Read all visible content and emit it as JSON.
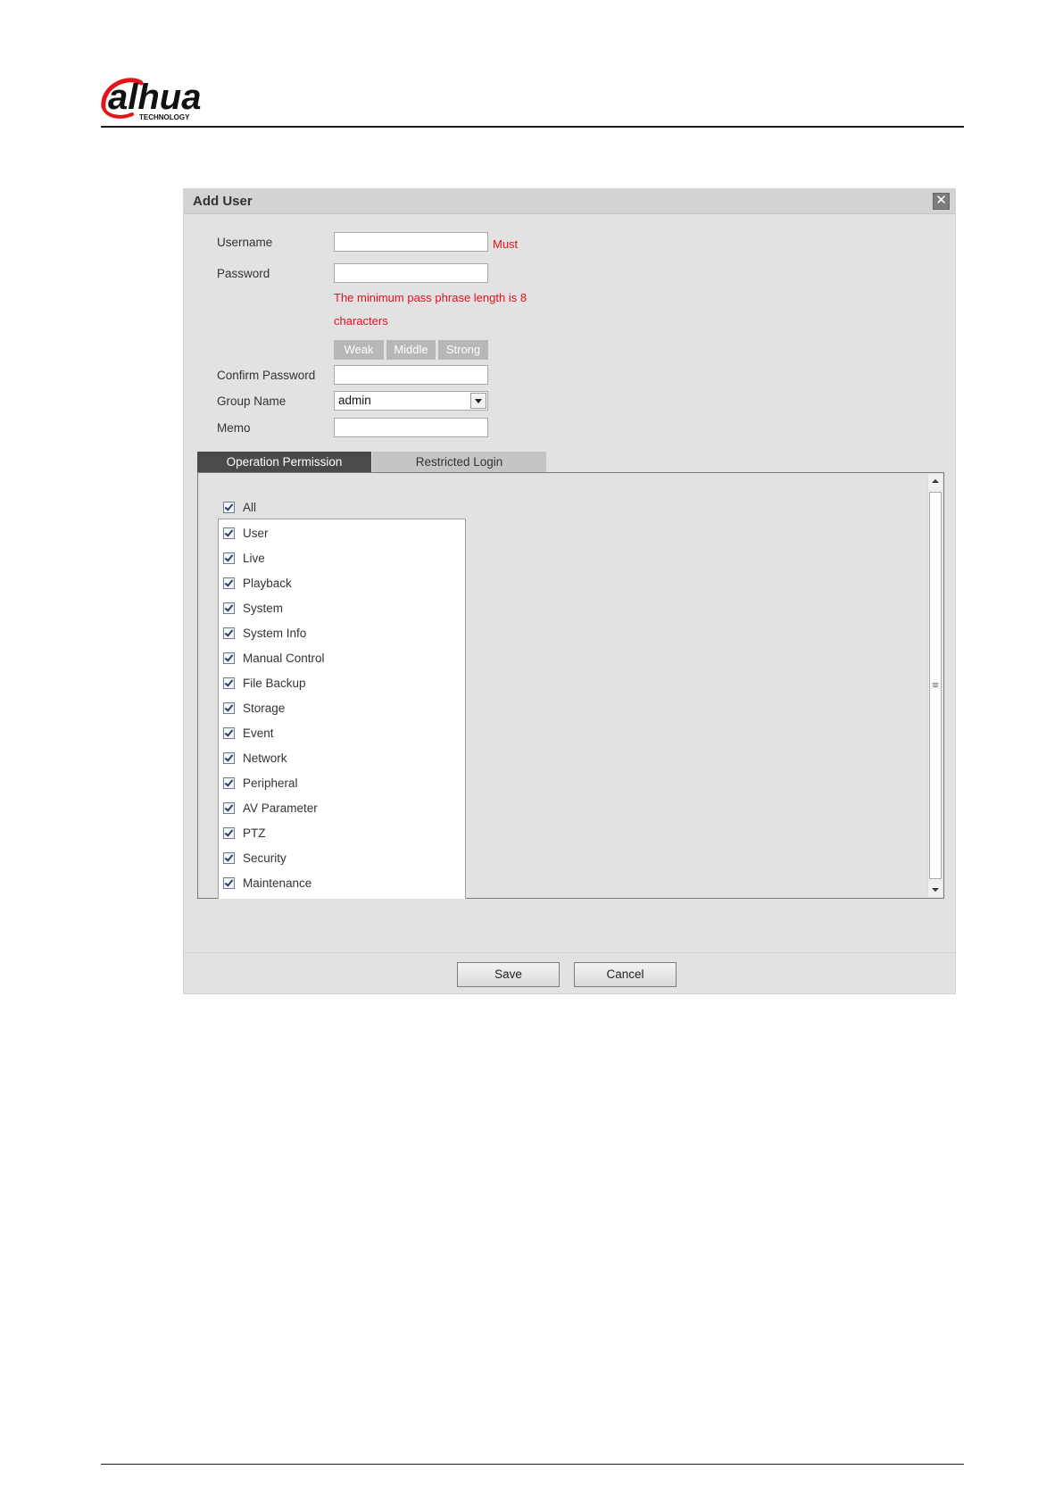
{
  "header": {
    "logo_text": "alhua",
    "logo_subtext": "TECHNOLOGY"
  },
  "dialog": {
    "title": "Add User",
    "close_icon": "close-icon",
    "fields": {
      "username_label": "Username",
      "username_value": "",
      "username_hint": "Must",
      "password_label": "Password",
      "password_value": "",
      "password_hint_line1": "The minimum pass phrase length is 8",
      "password_hint_line2": "characters",
      "strength": [
        "Weak",
        "Middle",
        "Strong"
      ],
      "confirm_label": "Confirm Password",
      "confirm_value": "",
      "group_label": "Group Name",
      "group_value": "admin",
      "memo_label": "Memo",
      "memo_value": ""
    },
    "tabs": [
      "Operation Permission",
      "Restricted Login"
    ],
    "active_tab": "Operation Permission",
    "all_label": "All",
    "permissions": [
      "User",
      "Live",
      "Playback",
      "System",
      "System Info",
      "Manual Control",
      "File Backup",
      "Storage",
      "Event",
      "Network",
      "Peripheral",
      "AV Parameter",
      "PTZ",
      "Security",
      "Maintenance"
    ],
    "all_checked": true,
    "buttons": {
      "save": "Save",
      "cancel": "Cancel"
    }
  },
  "colors": {
    "warning": "#e8101c",
    "active_tab": "#4a4a4a",
    "brand_red": "#e3151c"
  }
}
